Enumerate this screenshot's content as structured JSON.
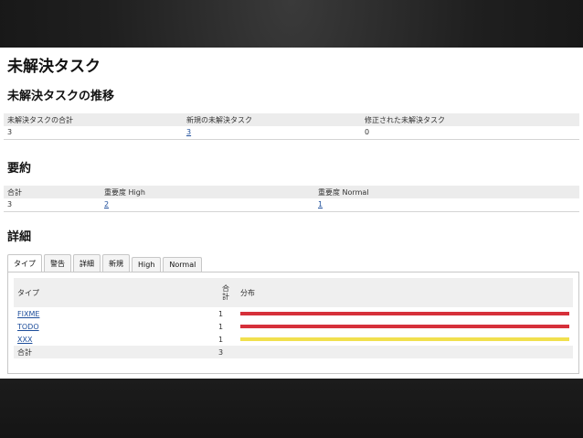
{
  "page_title": "未解決タスク",
  "trend": {
    "heading": "未解決タスクの推移",
    "columns": [
      "未解決タスクの合計",
      "新規の未解決タスク",
      "修正された未解決タスク"
    ],
    "values": [
      "3",
      "3",
      "0"
    ]
  },
  "summary": {
    "heading": "要約",
    "columns": [
      "合計",
      "重要度 High",
      "重要度 Normal"
    ],
    "values": [
      "3",
      "2",
      "1"
    ]
  },
  "details": {
    "heading": "詳細",
    "tabs": [
      "タイプ",
      "警告",
      "詳細",
      "新規",
      "High",
      "Normal"
    ],
    "table": {
      "col_type": "タイプ",
      "col_count_line1": "合",
      "col_count_line2": "計",
      "col_dist": "分布",
      "rows": [
        {
          "type": "FIXME",
          "count": "1",
          "bar_color": "#d6303a",
          "fraction": 1.0
        },
        {
          "type": "TODO",
          "count": "1",
          "bar_color": "#d6303a",
          "fraction": 1.0
        },
        {
          "type": "XXX",
          "count": "1",
          "bar_color": "#f1e04e",
          "fraction": 1.0
        }
      ],
      "total_label": "合計",
      "total_value": "3"
    }
  }
}
